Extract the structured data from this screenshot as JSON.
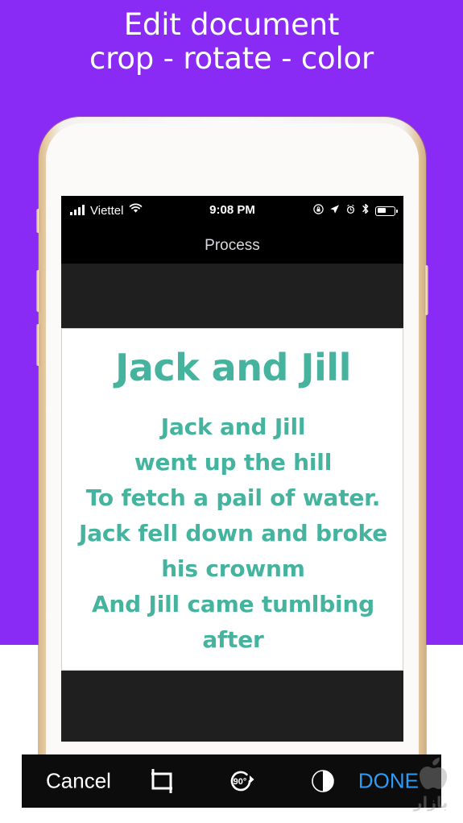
{
  "promo": {
    "headline_line1": "Edit document",
    "headline_line2": "crop - rotate - color",
    "background_color": "#8a2bf5",
    "headline_color": "#ffffff"
  },
  "phone": {
    "body_color": "#fbfaf8",
    "trim_color": "#d8b98e",
    "sensor_icon": "proximity-sensor-dot",
    "camera_icon": "front-camera-icon",
    "speaker_icon": "earpiece-speaker",
    "buttons": [
      {
        "name": "silent-switch"
      },
      {
        "name": "volume-up-button"
      },
      {
        "name": "volume-down-button"
      },
      {
        "name": "power-button"
      }
    ]
  },
  "status_bar": {
    "signal_icon": "cellular-signal-icon",
    "carrier": "Viettel",
    "wifi_icon": "wifi-icon",
    "time": "9:08 PM",
    "rotation_lock_icon": "rotation-lock-icon",
    "location_icon": "location-arrow-icon",
    "alarm_icon": "alarm-clock-icon",
    "bluetooth_icon": "bluetooth-icon",
    "battery_icon": "battery-icon",
    "battery_percent": 45
  },
  "nav_bar": {
    "title": "Process",
    "background_color": "#000000",
    "title_color": "#d8d8de"
  },
  "document": {
    "title": "Jack and Jill",
    "text_color": "#45b39d",
    "lines": [
      "Jack and Jill",
      "went up the hill",
      "To fetch a pail of water.",
      "Jack fell down and broke",
      "his crownm",
      "And Jill came tumlbing",
      "after"
    ]
  },
  "toolbar": {
    "background_color": "#0c0c0c",
    "cancel_label": "Cancel",
    "done_label": "DONE",
    "done_color": "#2f9bf5",
    "crop_icon": "crop-icon",
    "rotate_icon": "rotate-90-icon",
    "rotate_label": "90",
    "contrast_icon": "contrast-icon"
  },
  "watermark": {
    "icon": "apple-logo-icon",
    "label": "bazaar-watermark"
  }
}
